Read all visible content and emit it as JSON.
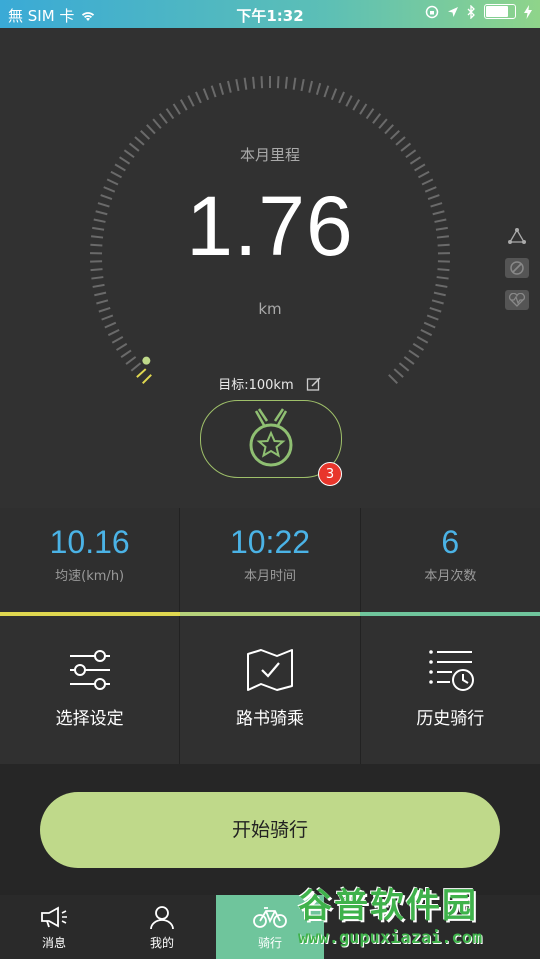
{
  "status_bar": {
    "carrier": "無 SIM 卡",
    "time": "下午1:32",
    "battery_level": 0.85
  },
  "dashboard": {
    "month_label": "本月里程",
    "distance": "1.76",
    "unit": "km",
    "goal": "目标:100km",
    "goal_progress": 0.0176,
    "medal_count": "3",
    "accent_color": "#bfd98a"
  },
  "stats": [
    {
      "value": "10.16",
      "label": "均速(km/h)"
    },
    {
      "value": "10:22",
      "label": "本月时间"
    },
    {
      "value": "6",
      "label": "本月次数"
    }
  ],
  "menu": [
    {
      "label": "选择设定",
      "icon": "sliders-icon"
    },
    {
      "label": "路书骑乘",
      "icon": "map-check-icon"
    },
    {
      "label": "历史骑行",
      "icon": "history-list-icon"
    }
  ],
  "start_button": "开始骑行",
  "tabs": [
    {
      "label": "消息",
      "icon": "megaphone-icon"
    },
    {
      "label": "我的",
      "icon": "person-icon"
    },
    {
      "label": "骑行",
      "icon": "bicycle-icon",
      "active": true
    }
  ],
  "watermark": {
    "title": "谷普软件园",
    "url": "www.gupuxiazai.com"
  }
}
